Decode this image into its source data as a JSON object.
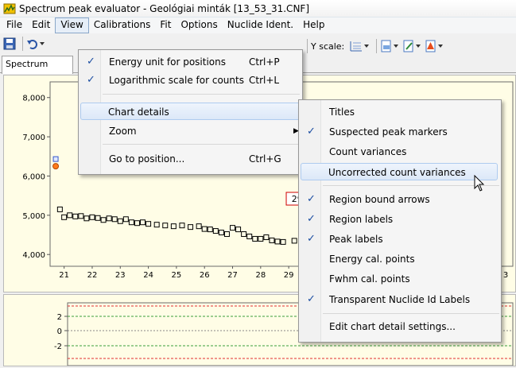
{
  "window": {
    "title": "Spectrum peak evaluator - Geológiai minták [13_53_31.CNF]"
  },
  "menubar": [
    "File",
    "Edit",
    "View",
    "Calibrations",
    "Fit",
    "Options",
    "Nuclide Ident.",
    "Help"
  ],
  "toolbar": {
    "yscale_label": "Y scale:"
  },
  "tabs": {
    "active": "Spectrum"
  },
  "view_menu": {
    "energy_unit": {
      "label": "Energy unit for positions",
      "shortcut": "Ctrl+P",
      "checked": true
    },
    "log_scale": {
      "label": "Logarithmic scale for counts",
      "shortcut": "Ctrl+L",
      "checked": true
    },
    "chart_details": "Chart details",
    "zoom": "Zoom",
    "go_to_position": {
      "label": "Go to position...",
      "shortcut": "Ctrl+G"
    }
  },
  "chart_details_menu": {
    "titles": "Titles",
    "suspected_peak_markers": "Suspected peak markers",
    "count_variances": "Count variances",
    "uncorrected_count_variances": "Uncorrected count variances",
    "region_bound_arrows": "Region bound arrows",
    "region_labels": "Region labels",
    "peak_labels": "Peak labels",
    "energy_cal_points": "Energy cal. points",
    "fwhm_cal_points": "Fwhm cal. points",
    "transparent_nuclide_id_labels": "Transparent Nuclide Id Labels",
    "edit_settings": "Edit chart detail settings..."
  },
  "chart_data": [
    {
      "type": "scatter",
      "y_ticks": [
        "8,000",
        "7,000",
        "6,000",
        "5,000",
        "4,000"
      ],
      "x_ticks": [
        "21",
        "22",
        "23",
        "24",
        "25",
        "26",
        "27",
        "28",
        "29",
        "30",
        "31",
        "32",
        "33",
        "34",
        "3"
      ],
      "x_tick_right": "3",
      "peak_label": "29.6",
      "ylim": [
        3700,
        8400
      ],
      "xlim": [
        20.5,
        35
      ],
      "points": [
        [
          20.85,
          5150
        ],
        [
          21.0,
          4950
        ],
        [
          21.2,
          5000
        ],
        [
          21.4,
          4970
        ],
        [
          21.6,
          4980
        ],
        [
          21.8,
          4920
        ],
        [
          22.0,
          4950
        ],
        [
          22.2,
          4930
        ],
        [
          22.4,
          4880
        ],
        [
          22.6,
          4920
        ],
        [
          22.8,
          4900
        ],
        [
          23.0,
          4850
        ],
        [
          23.2,
          4900
        ],
        [
          23.4,
          4820
        ],
        [
          23.6,
          4800
        ],
        [
          23.8,
          4820
        ],
        [
          24.0,
          4780
        ],
        [
          24.3,
          4760
        ],
        [
          24.6,
          4740
        ],
        [
          24.9,
          4720
        ],
        [
          25.2,
          4740
        ],
        [
          25.5,
          4700
        ],
        [
          25.8,
          4720
        ],
        [
          26.0,
          4650
        ],
        [
          26.2,
          4640
        ],
        [
          26.4,
          4600
        ],
        [
          26.6,
          4560
        ],
        [
          26.8,
          4520
        ],
        [
          27.0,
          4680
        ],
        [
          27.2,
          4640
        ],
        [
          27.4,
          4520
        ],
        [
          27.6,
          4460
        ],
        [
          27.8,
          4400
        ],
        [
          28.0,
          4400
        ],
        [
          28.2,
          4440
        ],
        [
          28.4,
          4360
        ],
        [
          28.6,
          4330
        ],
        [
          28.8,
          4320
        ],
        [
          29.2,
          4350
        ],
        [
          29.5,
          4360
        ],
        [
          29.7,
          4340
        ],
        [
          29.9,
          4330
        ],
        [
          30.1,
          4320
        ],
        [
          30.3,
          4310
        ],
        [
          30.5,
          4330
        ],
        [
          30.7,
          4300
        ],
        [
          30.9,
          4290
        ],
        [
          31.1,
          4300
        ],
        [
          31.3,
          4280
        ],
        [
          31.5,
          4270
        ],
        [
          31.7,
          4260
        ],
        [
          31.9,
          4250
        ],
        [
          32.1,
          4270
        ],
        [
          32.3,
          4250
        ],
        [
          32.5,
          4240
        ],
        [
          32.7,
          4230
        ],
        [
          32.9,
          4250
        ],
        [
          33.1,
          4230
        ],
        [
          33.3,
          4220
        ],
        [
          33.5,
          4210
        ],
        [
          33.7,
          4220
        ],
        [
          33.9,
          4200
        ],
        [
          34.1,
          4190
        ],
        [
          34.3,
          4180
        ]
      ],
      "red_points": [
        [
          29.55,
          4740
        ]
      ],
      "markers": [
        [
          20.7,
          6250
        ]
      ]
    },
    {
      "type": "line",
      "y_ticks": [
        "2",
        "0",
        "-2"
      ]
    }
  ]
}
